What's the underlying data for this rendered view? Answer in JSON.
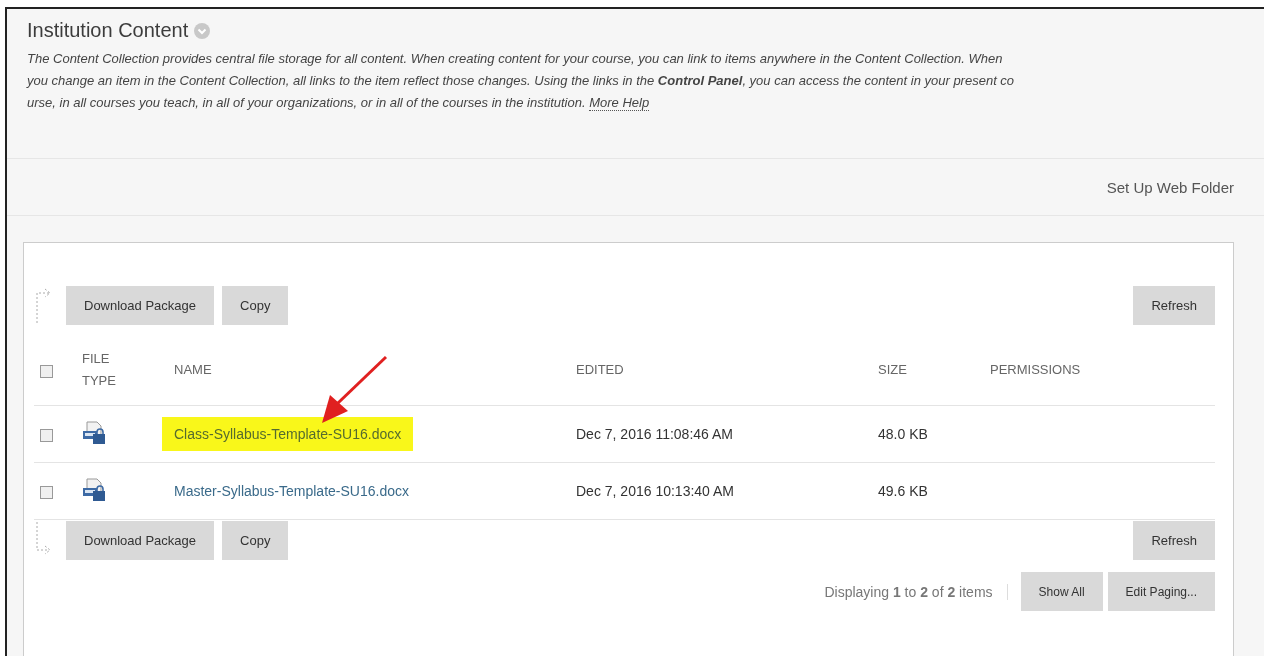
{
  "page": {
    "title": "Institution Content",
    "description": {
      "lines": [
        "The Content Collection provides central file storage for all content. When creating content for your course, you can link to items anywhere in the Content Collection. When",
        "you change an item in the Content Collection, all links to the item reflect those changes. Using the links in the **Control Panel**, you can access the content in your present co",
        "urse, in all courses you teach, in all of your organizations, or in all of the courses in the institution."
      ],
      "link": "More Help"
    }
  },
  "web_folder_link": "Set Up Web Folder",
  "top_actions": {
    "buttons": [
      "Download Package",
      "Copy"
    ],
    "refresh": "Refresh"
  },
  "table": {
    "select_all": {
      "checked": false
    },
    "columns": [
      "FILE\nTYPE",
      "NAME",
      "EDITED",
      "SIZE",
      "PERMISSIONS"
    ],
    "rows": [
      {
        "checked": false,
        "name": "Class-Syllabus-Template-SU16.docx",
        "highlighted": true,
        "edited": "Dec 7, 2016 11:08:46 AM",
        "size": "48.0 KB"
      },
      {
        "checked": false,
        "name": "Master-Syllabus-Template-SU16.docx",
        "highlighted": false,
        "edited": "Dec 7, 2016 10:13:40 AM",
        "size": "49.6 KB"
      }
    ]
  },
  "bottom_actions": {
    "buttons": [
      "Download Package",
      "Copy"
    ],
    "refresh": "Refresh"
  },
  "paging": {
    "summary": "Displaying **1** to **2** of **2** items",
    "buttons": [
      "Show All",
      "Edit Paging..."
    ]
  },
  "annotation": {
    "kind": "arrow"
  }
}
